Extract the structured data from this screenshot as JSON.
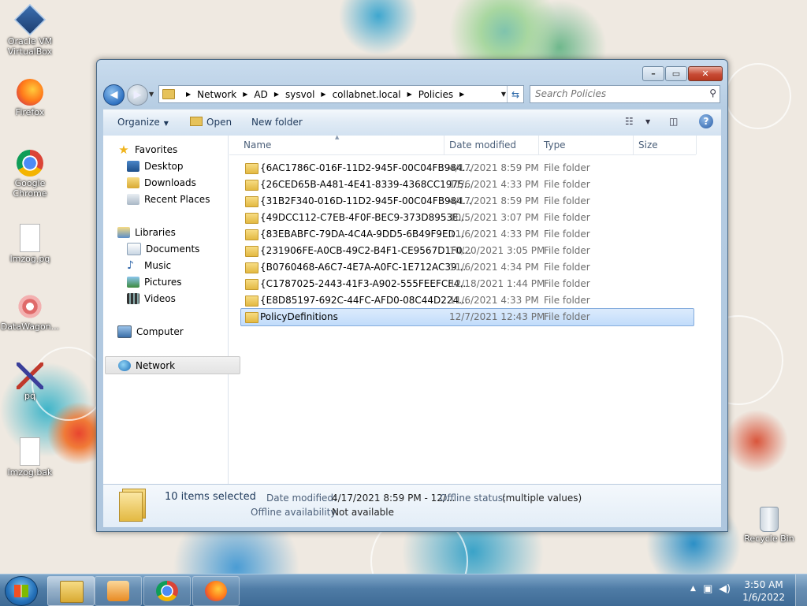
{
  "desktop": {
    "icons": [
      {
        "label": "Oracle VM\nVirtualBox",
        "icon": "virtualbox-icon"
      },
      {
        "label": "Firefox",
        "icon": "firefox-icon"
      },
      {
        "label": "Google\nChrome",
        "icon": "chrome-icon"
      },
      {
        "label": "lmzog.pq",
        "icon": "file-icon"
      },
      {
        "label": "DataWagon...",
        "icon": "datawagon-icon"
      },
      {
        "label": "pq",
        "icon": "pq-icon"
      },
      {
        "label": "lmzog.bak",
        "icon": "file-icon"
      },
      {
        "label": "Recycle Bin",
        "icon": "recycle-bin-icon"
      }
    ]
  },
  "window": {
    "caption": {
      "minimize": "–",
      "maximize": "▭",
      "close": "✕"
    },
    "breadcrumb": [
      "Network",
      "AD",
      "sysvol",
      "collabnet.local",
      "Policies"
    ],
    "search_placeholder": "Search Policies",
    "toolbar": {
      "organize": "Organize",
      "open": "Open",
      "new_folder": "New folder"
    },
    "nav": {
      "favorites": "Favorites",
      "desktop": "Desktop",
      "downloads": "Downloads",
      "recent_places": "Recent Places",
      "libraries": "Libraries",
      "documents": "Documents",
      "music": "Music",
      "pictures": "Pictures",
      "videos": "Videos",
      "computer": "Computer",
      "network": "Network"
    },
    "columns": {
      "name": "Name",
      "date": "Date modified",
      "type": "Type",
      "size": "Size"
    },
    "files": [
      {
        "name": "{6AC1786C-016F-11D2-945F-00C04FB984...",
        "date": "4/17/2021 8:59 PM",
        "type": "File folder"
      },
      {
        "name": "{26CED65B-A481-4E41-8339-4368CC1975...",
        "date": "11/6/2021 4:33 PM",
        "type": "File folder"
      },
      {
        "name": "{31B2F340-016D-11D2-945F-00C04FB984...",
        "date": "4/17/2021 8:59 PM",
        "type": "File folder"
      },
      {
        "name": "{49DCC112-C7EB-4F0F-BEC9-373D8953E...",
        "date": "10/5/2021 3:07 PM",
        "type": "File folder"
      },
      {
        "name": "{83EBABFC-79DA-4C4A-9DD5-6B49F9ED...",
        "date": "11/6/2021 4:33 PM",
        "type": "File folder"
      },
      {
        "name": "{231906FE-A0CB-49C2-B4F1-CE9567D1F0...",
        "date": "10/20/2021 3:05 PM",
        "type": "File folder"
      },
      {
        "name": "{B0760468-A6C7-4E7A-A0FC-1E712AC39...",
        "date": "11/6/2021 4:34 PM",
        "type": "File folder"
      },
      {
        "name": "{C1787025-2443-41F3-A902-555FEEFCE4...",
        "date": "12/18/2021 1:44 PM",
        "type": "File folder"
      },
      {
        "name": "{E8D85197-692C-44FC-AFD0-08C44D224...",
        "date": "11/6/2021 4:33 PM",
        "type": "File folder"
      },
      {
        "name": "PolicyDefinitions",
        "date": "12/7/2021 12:43 PM",
        "type": "File folder"
      }
    ],
    "details": {
      "selected": "10 items selected",
      "date_label": "Date modified:",
      "date_value": "4/17/2021 8:59 PM - 12/...",
      "offline_status_label": "Offline status:",
      "offline_status_value": "(multiple values)",
      "offline_avail_label": "Offline availability:",
      "offline_avail_value": "Not available"
    }
  },
  "taskbar": {
    "clock_time": "3:50 AM",
    "clock_date": "1/6/2022"
  }
}
